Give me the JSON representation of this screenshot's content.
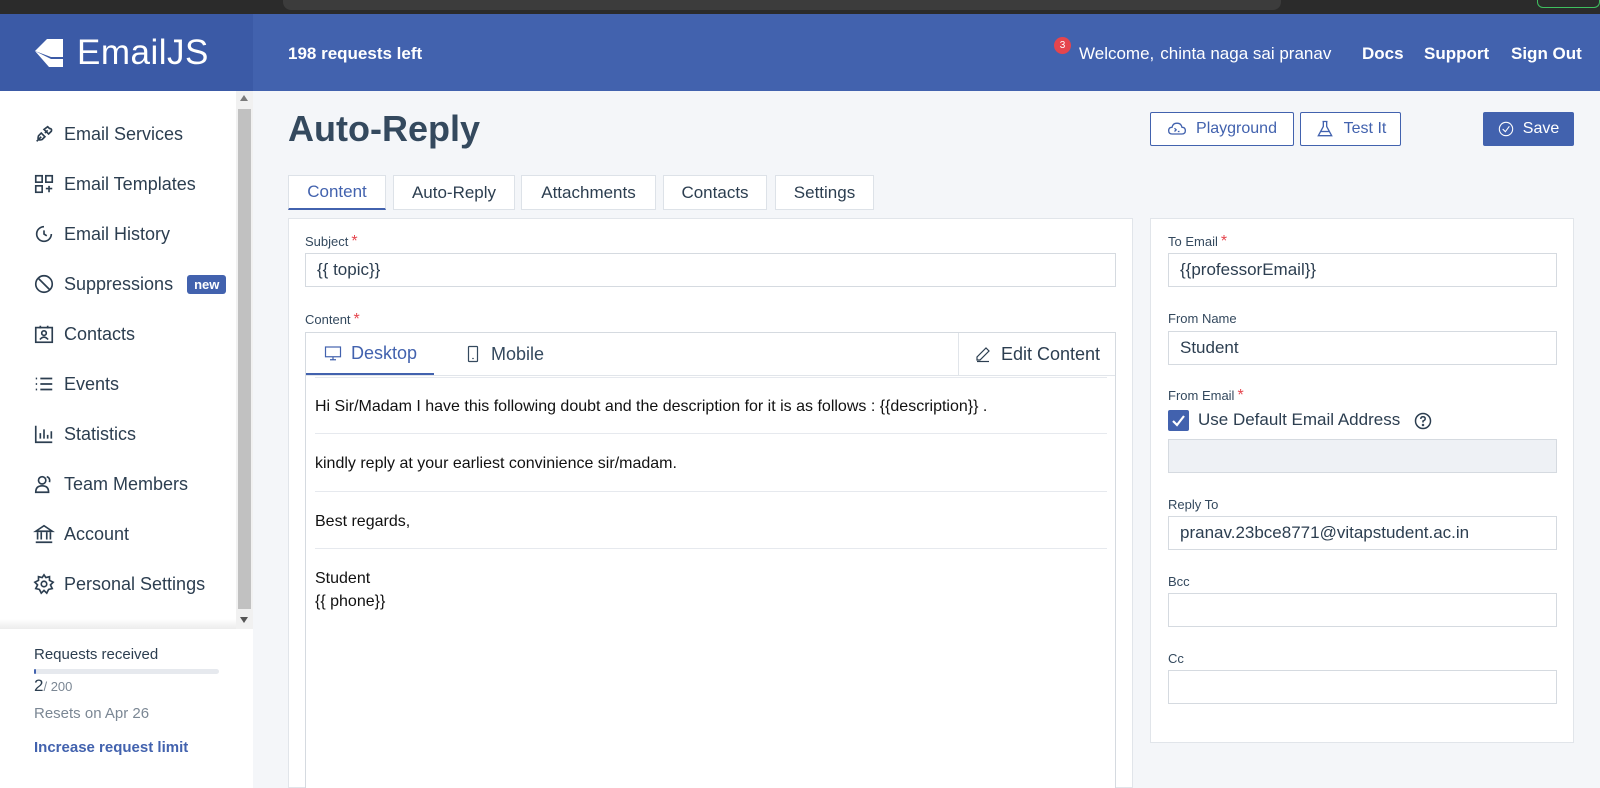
{
  "header": {
    "brand": "EmailJS",
    "requests_left": "198 requests left",
    "notification_count": "3",
    "welcome_label": "Welcome,",
    "user_name": "chinta naga sai pranav",
    "links": {
      "docs": "Docs",
      "support": "Support",
      "sign_out": "Sign Out"
    }
  },
  "sidebar": {
    "items": [
      {
        "label": "Email Services",
        "icon": "plug-icon"
      },
      {
        "label": "Email Templates",
        "icon": "templates-icon"
      },
      {
        "label": "Email History",
        "icon": "history-icon"
      },
      {
        "label": "Suppressions",
        "icon": "block-icon",
        "badge": "new"
      },
      {
        "label": "Contacts",
        "icon": "contacts-icon"
      },
      {
        "label": "Events",
        "icon": "list-icon"
      },
      {
        "label": "Statistics",
        "icon": "bar-chart-icon"
      },
      {
        "label": "Team Members",
        "icon": "team-icon"
      },
      {
        "label": "Account",
        "icon": "bank-icon"
      },
      {
        "label": "Personal Settings",
        "icon": "gear-icon"
      }
    ],
    "usage": {
      "label": "Requests received",
      "count": "2",
      "total": "/ 200",
      "progress_fraction": 0.01,
      "reset_text": "Resets on Apr 26",
      "increase_link": "Increase request limit"
    }
  },
  "page": {
    "title": "Auto-Reply",
    "buttons": {
      "playground": "Playground",
      "test_it": "Test It",
      "save": "Save"
    },
    "tabs": [
      {
        "label": "Content",
        "active": true
      },
      {
        "label": "Auto-Reply",
        "active": false
      },
      {
        "label": "Attachments",
        "active": false
      },
      {
        "label": "Contacts",
        "active": false
      },
      {
        "label": "Settings",
        "active": false
      }
    ]
  },
  "content_panel": {
    "subject_label": "Subject",
    "subject_value": "{{ topic}}",
    "content_label": "Content",
    "editor_tabs": {
      "desktop": "Desktop",
      "mobile": "Mobile",
      "edit": "Edit Content"
    },
    "body_lines": [
      "Hi Sir/Madam I have this following doubt and the description for it is as follows : {{description}} .",
      "kindly reply at your earliest convinience sir/madam.",
      "Best regards,",
      "Student",
      "{{ phone}}"
    ]
  },
  "settings_panel": {
    "to_email_label": "To Email",
    "to_email_value": "{{professorEmail}}",
    "from_name_label": "From Name",
    "from_name_value": "Student",
    "from_email_label": "From Email",
    "use_default_label": "Use Default Email Address",
    "use_default_checked": true,
    "reply_to_label": "Reply To",
    "reply_to_value": "pranav.23bce8771@vitapstudent.ac.in",
    "bcc_label": "Bcc",
    "bcc_value": "",
    "cc_label": "Cc",
    "cc_value": ""
  },
  "colors": {
    "header_bg": "#4262ae",
    "accent": "#4262ae",
    "required": "#e5454d"
  }
}
